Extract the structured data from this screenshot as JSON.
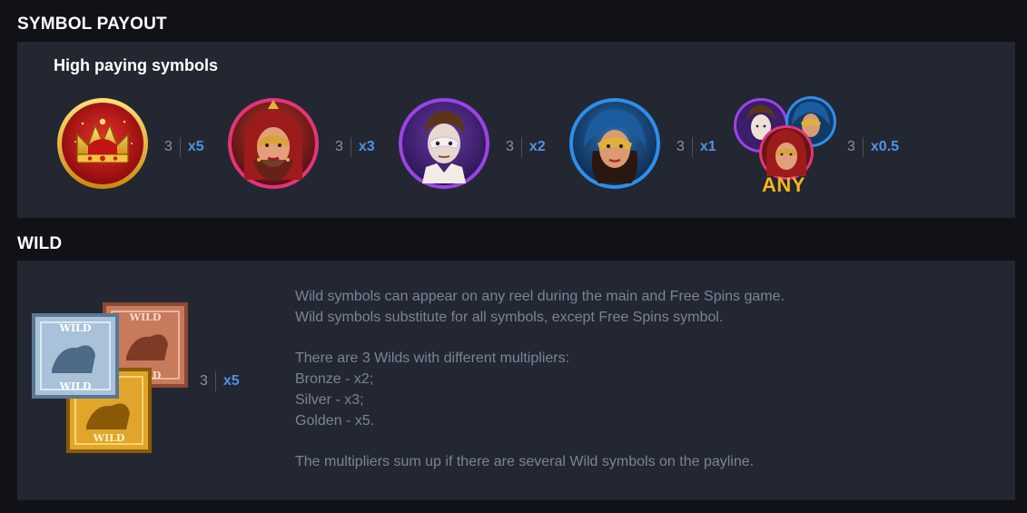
{
  "sections": {
    "payout_title": "SYMBOL PAYOUT",
    "wild_title": "WILD"
  },
  "payout": {
    "subheading": "High paying symbols",
    "symbols": [
      {
        "icon": "crown-symbol-icon",
        "count": "3",
        "multiplier": "x5",
        "ring_color": "#f2c230"
      },
      {
        "icon": "red-lady-symbol-icon",
        "count": "3",
        "multiplier": "x3",
        "ring_color": "#e2357a"
      },
      {
        "icon": "white-mask-man-symbol-icon",
        "count": "3",
        "multiplier": "x2",
        "ring_color": "#9a44e6"
      },
      {
        "icon": "blue-mask-lady-symbol-icon",
        "count": "3",
        "multiplier": "x1",
        "ring_color": "#2f8ee8"
      },
      {
        "icon": "any-character-symbol-icon",
        "count": "3",
        "multiplier": "x0.5",
        "label": "ANY"
      }
    ]
  },
  "wild": {
    "count": "3",
    "multiplier": "x5",
    "tile_label": "WILD",
    "tiles": [
      {
        "icon": "bronze-wild-icon",
        "color": "#c77a5c"
      },
      {
        "icon": "silver-wild-icon",
        "color": "#a9c2d9"
      },
      {
        "icon": "golden-wild-icon",
        "color": "#e0a52a"
      }
    ],
    "lines": [
      "Wild symbols can appear on any reel during the main and Free Spins game.",
      "Wild symbols substitute for all symbols, except Free Spins symbol.",
      "",
      "There are 3 Wilds with different multipliers:",
      "Bronze - x2;",
      "Silver - x3;",
      "Golden - x5.",
      "",
      "The multipliers sum up if there are several Wild symbols on the payline."
    ]
  }
}
